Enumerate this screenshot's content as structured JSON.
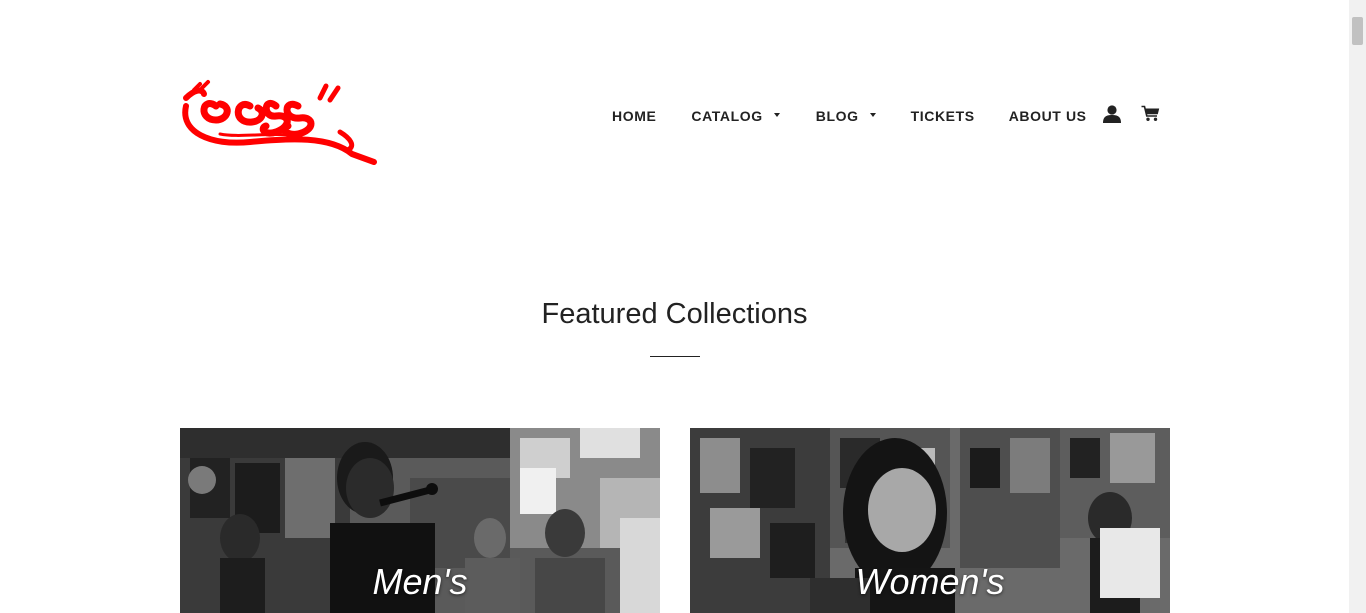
{
  "header": {
    "logo_icon": "graffiti-logo",
    "logo_color": "#ff0000",
    "nav": [
      {
        "label": "HOME",
        "has_dropdown": false
      },
      {
        "label": "CATALOG",
        "has_dropdown": true
      },
      {
        "label": "BLOG",
        "has_dropdown": true
      },
      {
        "label": "TICKETS",
        "has_dropdown": false
      },
      {
        "label": "ABOUT US",
        "has_dropdown": false
      }
    ],
    "account_icon": "user-icon",
    "cart_icon": "cart-icon"
  },
  "featured": {
    "title": "Featured Collections",
    "collections": [
      {
        "label": "Men's",
        "image": "grayscale photo of man singing into microphone in shop"
      },
      {
        "label": "Women's",
        "image": "grayscale photo of smiling woman in art-covered shop"
      }
    ]
  }
}
